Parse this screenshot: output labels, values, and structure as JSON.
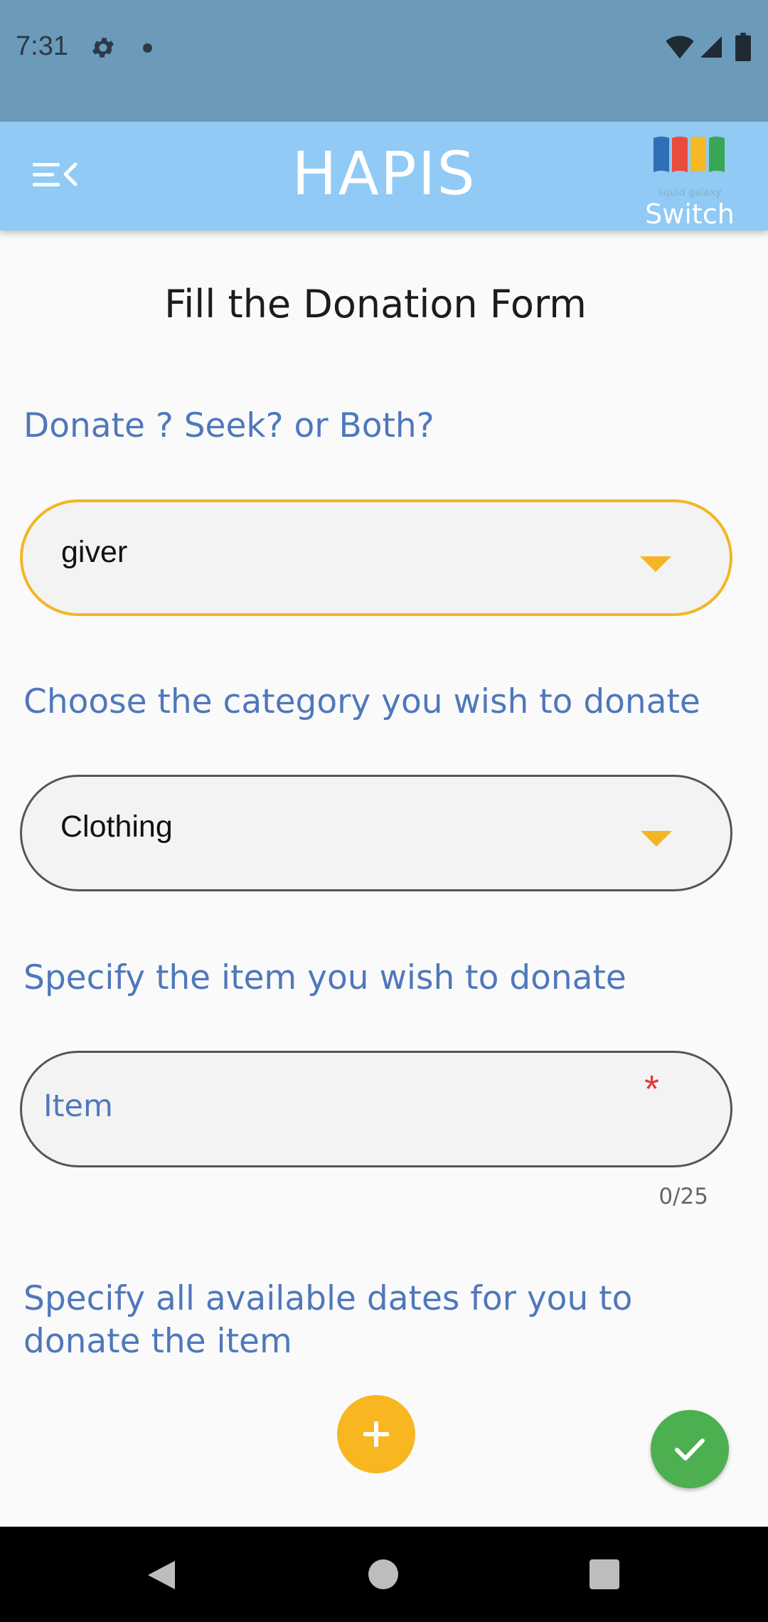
{
  "status_bar": {
    "time": "7:31",
    "icons": [
      "gear-icon",
      "notification-dot-icon",
      "wifi-icon",
      "signal-icon",
      "battery-icon"
    ]
  },
  "app_bar": {
    "title": "HAPIS",
    "logo_caption": "liquid galaxy",
    "switch_label": "Switch",
    "menu_icon": "menu-collapse-icon",
    "logo_colors": [
      "#2f6fb7",
      "#e94b3c",
      "#f6b925",
      "#3aa757"
    ]
  },
  "form": {
    "page_title": "Fill the Donation Form",
    "role_section": {
      "label": "Donate ? Seek? or Both?",
      "selected_value": "giver"
    },
    "category_section": {
      "label": "Choose the category you wish to donate",
      "selected_value": "Clothing"
    },
    "item_section": {
      "label": "Specify the item you wish to donate",
      "placeholder": "Item",
      "required_mark": "*",
      "counter": "0/25"
    },
    "dates_section": {
      "label": "Specify all available dates for you to donate the item"
    }
  },
  "actions": {
    "add_icon": "plus-icon",
    "confirm_icon": "check-icon"
  },
  "colors": {
    "status_bar": "#6c9aba",
    "app_bar": "#90caf5",
    "accent_yellow": "#f8b621",
    "label_blue": "#4f78bb",
    "confirm_green": "#4caf50",
    "required_red": "#e53935"
  },
  "nav_bar": {
    "buttons": [
      "back-icon",
      "home-icon",
      "recent-apps-icon"
    ]
  }
}
